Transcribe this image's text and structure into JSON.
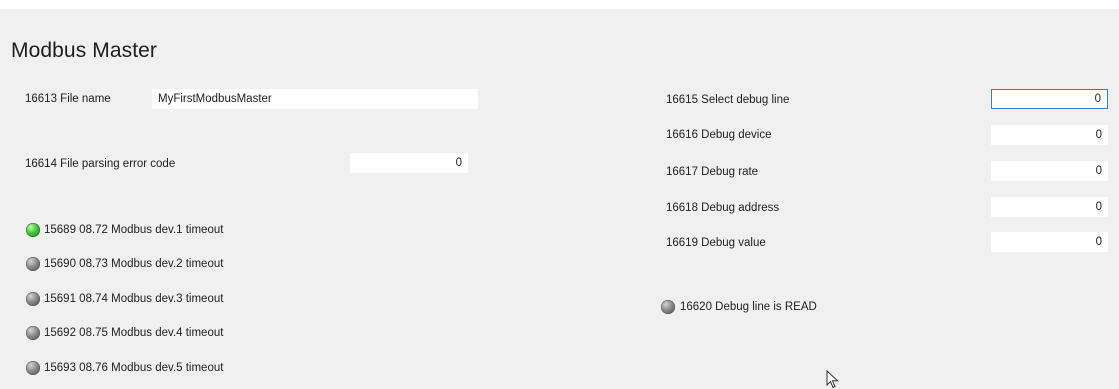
{
  "title": "Modbus Master",
  "left": {
    "file_name": {
      "label": "16613 File name",
      "value": "MyFirstModbusMaster"
    },
    "parse_error": {
      "label": "16614 File parsing error code",
      "value": "0"
    },
    "timeouts": [
      {
        "label": "15689 08.72 Modbus dev.1 timeout",
        "state": "green"
      },
      {
        "label": "15690 08.73 Modbus dev.2 timeout",
        "state": "grey"
      },
      {
        "label": "15691 08.74 Modbus dev.3 timeout",
        "state": "grey"
      },
      {
        "label": "15692 08.75 Modbus dev.4 timeout",
        "state": "grey"
      },
      {
        "label": "15693 08.76 Modbus dev.5 timeout",
        "state": "grey"
      }
    ]
  },
  "right": {
    "fields": [
      {
        "label": "16615 Select debug line",
        "value": "0"
      },
      {
        "label": "16616 Debug device",
        "value": "0"
      },
      {
        "label": "16617 Debug rate",
        "value": "0"
      },
      {
        "label": "16618 Debug address",
        "value": "0"
      },
      {
        "label": "16619 Debug value",
        "value": "0"
      }
    ],
    "debug_read": {
      "label": "16620 Debug line is READ",
      "state": "grey"
    }
  },
  "colors": {
    "panel_bg": "#f0f0f0",
    "led_on": "#3fc83c",
    "led_off": "#7a7a7a",
    "focus_border": "#3a7ac6"
  }
}
